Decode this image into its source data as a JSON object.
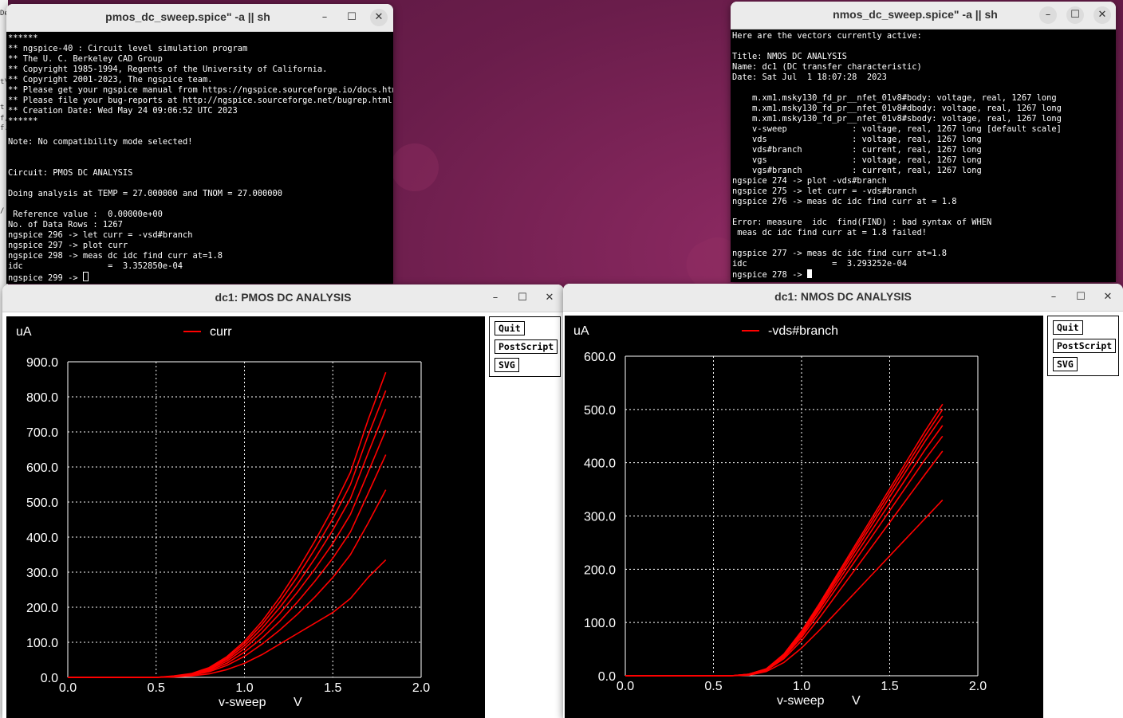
{
  "desktop": {
    "left_strip_text": [
      "De",
      "t\\",
      "t",
      "f,",
      "/",
      "f."
    ]
  },
  "pmos_term": {
    "title": "pmos_dc_sweep.spice\" -a || sh",
    "controls": {
      "minimize": "–",
      "maximize": "☐",
      "close": "✕"
    },
    "lines": [
      "******",
      "** ngspice-40 : Circuit level simulation program",
      "** The U. C. Berkeley CAD Group",
      "** Copyright 1985-1994, Regents of the University of California.",
      "** Copyright 2001-2023, The ngspice team.",
      "** Please get your ngspice manual from https://ngspice.sourceforge.io/docs.html",
      "** Please file your bug-reports at http://ngspice.sourceforge.net/bugrep.html",
      "** Creation Date: Wed May 24 09:06:52 UTC 2023",
      "******",
      "",
      "Note: No compatibility mode selected!",
      "",
      "",
      "Circuit: PMOS DC ANALYSIS",
      "",
      "Doing analysis at TEMP = 27.000000 and TNOM = 27.000000",
      "",
      " Reference value :  0.00000e+00",
      "No. of Data Rows : 1267",
      "ngspice 296 -> let curr = -vsd#branch",
      "ngspice 297 -> plot curr",
      "ngspice 298 -> meas dc idc find curr at=1.8",
      "idc                 =  3.352850e-04"
    ],
    "prompt": "ngspice 299 -> "
  },
  "nmos_term": {
    "title": "nmos_dc_sweep.spice\" -a || sh",
    "controls": {
      "minimize": "–",
      "maximize": "☐",
      "close": "✕"
    },
    "lines": [
      "Here are the vectors currently active:",
      "",
      "Title: NMOS DC ANALYSIS",
      "Name: dc1 (DC transfer characteristic)",
      "Date: Sat Jul  1 18:07:28  2023",
      "",
      "    m.xm1.msky130_fd_pr__nfet_01v8#body: voltage, real, 1267 long",
      "    m.xm1.msky130_fd_pr__nfet_01v8#dbody: voltage, real, 1267 long",
      "    m.xm1.msky130_fd_pr__nfet_01v8#sbody: voltage, real, 1267 long",
      "    v-sweep             : voltage, real, 1267 long [default scale]",
      "    vds                 : voltage, real, 1267 long",
      "    vds#branch          : current, real, 1267 long",
      "    vgs                 : voltage, real, 1267 long",
      "    vgs#branch          : current, real, 1267 long",
      "ngspice 274 -> plot -vds#branch",
      "ngspice 275 -> let curr = -vds#branch",
      "ngspice 276 -> meas dc idc find curr at = 1.8",
      "",
      "Error: measure  idc  find(FIND) : bad syntax of WHEN",
      " meas dc idc find curr at = 1.8 failed!",
      "",
      "ngspice 277 -> meas dc idc find curr at=1.8",
      "idc                 =  3.293252e-04"
    ],
    "prompt": "ngspice 278 -> "
  },
  "pmos_plot": {
    "title": "dc1: PMOS DC ANALYSIS",
    "controls": {
      "minimize": "–",
      "maximize": "☐",
      "close": "✕"
    },
    "buttons": {
      "quit": "Quit",
      "postscript": "PostScript",
      "svg": "SVG"
    }
  },
  "nmos_plot": {
    "title": "dc1: NMOS DC ANALYSIS",
    "controls": {
      "minimize": "–",
      "maximize": "☐",
      "close": "✕"
    },
    "buttons": {
      "quit": "Quit",
      "postscript": "PostScript",
      "svg": "SVG"
    }
  },
  "chart_data": [
    {
      "type": "line",
      "title": "",
      "ylabel": "uA",
      "xlabel": "v-sweep",
      "xunit": "V",
      "xlim": [
        0,
        2
      ],
      "ylim": [
        0,
        900
      ],
      "xticks": [
        "0.0",
        "0.5",
        "1.0",
        "1.5",
        "2.0"
      ],
      "yticks": [
        "0.0",
        "100.0",
        "200.0",
        "300.0",
        "400.0",
        "500.0",
        "600.0",
        "700.0",
        "800.0",
        "900.0"
      ],
      "grid": true,
      "legend": "top-left",
      "color": "#ff0000",
      "series": [
        {
          "name": "curr",
          "x": [
            0,
            0.5,
            0.6,
            0.7,
            0.8,
            0.9,
            1.0,
            1.1,
            1.2,
            1.3,
            1.4,
            1.5,
            1.6,
            1.7,
            1.8
          ],
          "values": [
            0,
            0,
            1,
            4,
            10,
            22,
            40,
            65,
            95,
            125,
            155,
            185,
            225,
            285,
            335
          ]
        },
        {
          "x": [
            0,
            0.5,
            0.6,
            0.7,
            0.8,
            0.9,
            1.0,
            1.1,
            1.2,
            1.3,
            1.4,
            1.5,
            1.6,
            1.7,
            1.8
          ],
          "values": [
            0,
            0,
            2,
            6,
            16,
            34,
            60,
            95,
            135,
            180,
            230,
            285,
            350,
            440,
            535
          ]
        },
        {
          "x": [
            0,
            0.5,
            0.6,
            0.7,
            0.8,
            0.9,
            1.0,
            1.1,
            1.2,
            1.3,
            1.4,
            1.5,
            1.6,
            1.7,
            1.8
          ],
          "values": [
            0,
            0,
            2,
            7,
            19,
            40,
            72,
            112,
            160,
            215,
            275,
            340,
            415,
            525,
            635
          ]
        },
        {
          "x": [
            0,
            0.5,
            0.6,
            0.7,
            0.8,
            0.9,
            1.0,
            1.1,
            1.2,
            1.3,
            1.4,
            1.5,
            1.6,
            1.7,
            1.8
          ],
          "values": [
            0,
            0,
            3,
            8,
            22,
            46,
            82,
            128,
            182,
            243,
            310,
            382,
            465,
            585,
            705
          ]
        },
        {
          "x": [
            0,
            0.5,
            0.6,
            0.7,
            0.8,
            0.9,
            1.0,
            1.1,
            1.2,
            1.3,
            1.4,
            1.5,
            1.6,
            1.7,
            1.8
          ],
          "values": [
            0,
            0,
            3,
            9,
            24,
            51,
            90,
            140,
            199,
            266,
            340,
            420,
            510,
            640,
            765
          ]
        },
        {
          "x": [
            0,
            0.5,
            0.6,
            0.7,
            0.8,
            0.9,
            1.0,
            1.1,
            1.2,
            1.3,
            1.4,
            1.5,
            1.6,
            1.7,
            1.8
          ],
          "values": [
            0,
            0,
            3,
            10,
            26,
            55,
            97,
            151,
            215,
            287,
            367,
            453,
            550,
            690,
            818
          ]
        },
        {
          "x": [
            0,
            0.5,
            0.6,
            0.7,
            0.8,
            0.9,
            1.0,
            1.1,
            1.2,
            1.3,
            1.4,
            1.5,
            1.6,
            1.7,
            1.8
          ],
          "values": [
            0,
            0,
            4,
            11,
            28,
            59,
            103,
            160,
            228,
            305,
            390,
            482,
            585,
            735,
            870
          ]
        }
      ]
    },
    {
      "type": "line",
      "title": "",
      "ylabel": "uA",
      "xlabel": "v-sweep",
      "xunit": "V",
      "xlim": [
        0,
        2
      ],
      "ylim": [
        0,
        600
      ],
      "xticks": [
        "0.0",
        "0.5",
        "1.0",
        "1.5",
        "2.0"
      ],
      "yticks": [
        "0.0",
        "100.0",
        "200.0",
        "300.0",
        "400.0",
        "500.0",
        "600.0"
      ],
      "grid": true,
      "legend": "top-left",
      "color": "#ff0000",
      "series": [
        {
          "name": "-vds#branch",
          "x": [
            0,
            0.6,
            0.7,
            0.8,
            0.9,
            1.0,
            1.1,
            1.2,
            1.3,
            1.4,
            1.5,
            1.6,
            1.7,
            1.8
          ],
          "values": [
            0,
            0,
            1,
            8,
            25,
            52,
            85,
            120,
            155,
            190,
            225,
            260,
            295,
            330
          ]
        },
        {
          "x": [
            0,
            0.6,
            0.7,
            0.8,
            0.9,
            1.0,
            1.1,
            1.2,
            1.3,
            1.4,
            1.5,
            1.6,
            1.7,
            1.8
          ],
          "values": [
            0,
            0,
            2,
            10,
            32,
            66,
            108,
            153,
            198,
            243,
            288,
            333,
            378,
            422
          ]
        },
        {
          "x": [
            0,
            0.6,
            0.7,
            0.8,
            0.9,
            1.0,
            1.1,
            1.2,
            1.3,
            1.4,
            1.5,
            1.6,
            1.7,
            1.8
          ],
          "values": [
            0,
            0,
            2,
            11,
            35,
            72,
            118,
            166,
            214,
            262,
            310,
            358,
            406,
            450
          ]
        },
        {
          "x": [
            0,
            0.6,
            0.7,
            0.8,
            0.9,
            1.0,
            1.1,
            1.2,
            1.3,
            1.4,
            1.5,
            1.6,
            1.7,
            1.8
          ],
          "values": [
            0,
            0,
            2,
            12,
            37,
            76,
            124,
            174,
            224,
            274,
            324,
            374,
            424,
            470
          ]
        },
        {
          "x": [
            0,
            0.6,
            0.7,
            0.8,
            0.9,
            1.0,
            1.1,
            1.2,
            1.3,
            1.4,
            1.5,
            1.6,
            1.7,
            1.8
          ],
          "values": [
            0,
            0,
            3,
            12,
            38,
            79,
            128,
            180,
            232,
            284,
            336,
            388,
            440,
            488
          ]
        },
        {
          "x": [
            0,
            0.6,
            0.7,
            0.8,
            0.9,
            1.0,
            1.1,
            1.2,
            1.3,
            1.4,
            1.5,
            1.6,
            1.7,
            1.8
          ],
          "values": [
            0,
            0,
            3,
            13,
            40,
            82,
            132,
            185,
            238,
            291,
            344,
            397,
            450,
            500
          ]
        },
        {
          "x": [
            0,
            0.6,
            0.7,
            0.8,
            0.9,
            1.0,
            1.1,
            1.2,
            1.3,
            1.4,
            1.5,
            1.6,
            1.7,
            1.8
          ],
          "values": [
            0,
            0,
            3,
            13,
            41,
            84,
            135,
            189,
            243,
            297,
            351,
            405,
            459,
            510
          ]
        }
      ]
    }
  ]
}
